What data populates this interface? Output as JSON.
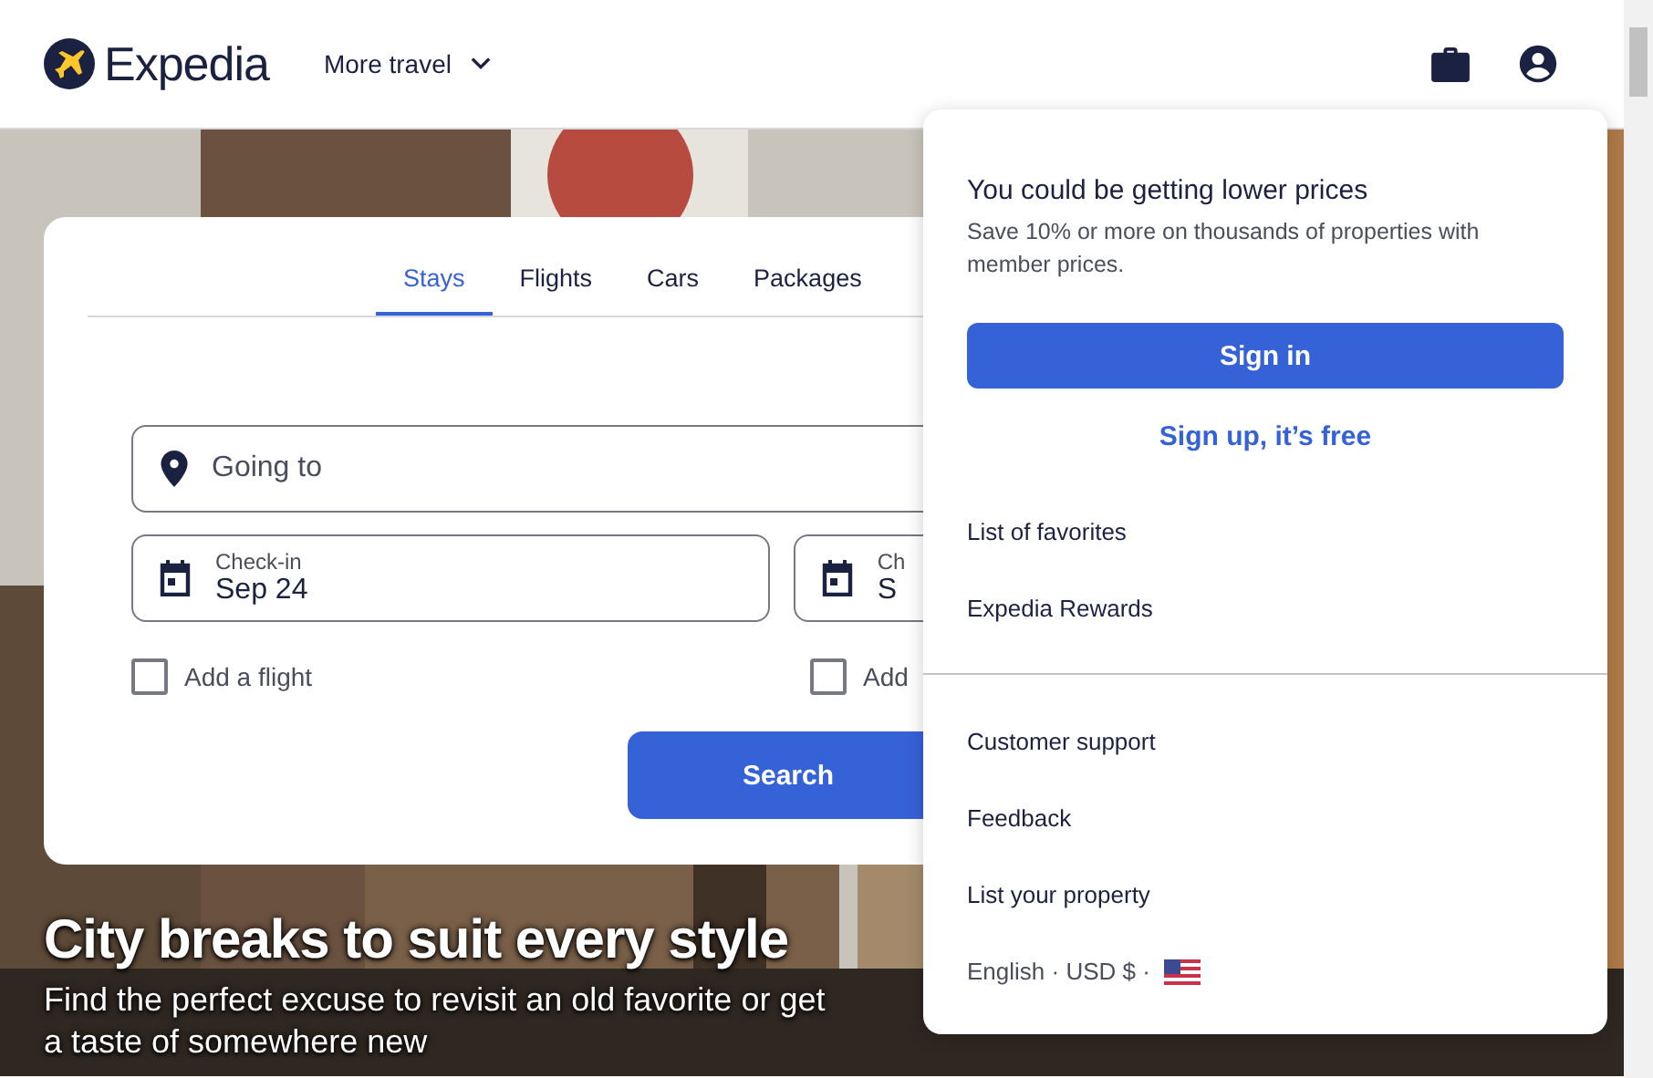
{
  "header": {
    "logo": "Expedia",
    "nav_menu": "More travel"
  },
  "search_card": {
    "tabs": [
      {
        "label": "Stays",
        "selected": true
      },
      {
        "label": "Flights",
        "selected": false
      },
      {
        "label": "Cars",
        "selected": false
      },
      {
        "label": "Packages",
        "selected": false
      }
    ],
    "destination": {
      "placeholder": "Going to"
    },
    "dates": [
      {
        "label": "Check-in",
        "value": "Sep 24"
      },
      {
        "label": "Ch",
        "value": "S"
      }
    ],
    "options": [
      {
        "label": "Add a flight",
        "checked": false
      },
      {
        "label": "Add",
        "checked": false
      }
    ],
    "search_button": "Search"
  },
  "hero": {
    "title": "City breaks to suit every style",
    "subtitle": "Find the perfect excuse to revisit an old favorite or get a taste of somewhere new"
  },
  "account_menu": {
    "heading": "You could be getting lower prices",
    "description": "Save 10% or more on thousands of properties with member prices.",
    "sign_in_button": "Sign in",
    "sign_up_link": "Sign up, it’s free",
    "sections": [
      [
        "List of favorites",
        "Expedia Rewards"
      ],
      [
        "Customer support",
        "Feedback",
        "List your property"
      ]
    ],
    "locale": "English · USD $ ·"
  }
}
